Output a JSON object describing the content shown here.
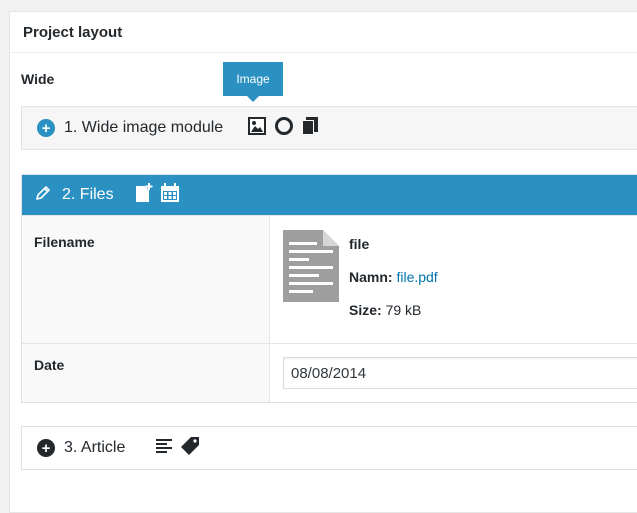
{
  "panel": {
    "title": "Project layout"
  },
  "section": {
    "label": "Wide"
  },
  "tooltip": {
    "text": "Image"
  },
  "modules": [
    {
      "title": "1. Wide image module",
      "tools": [
        "image-icon",
        "circle-outline-icon",
        "copy-icon"
      ]
    },
    {
      "title": "2. Files",
      "tools": [
        "file-add-icon",
        "calendar-icon"
      ]
    },
    {
      "title": "3. Article",
      "tools": [
        "align-left-icon",
        "tag-icon"
      ]
    }
  ],
  "files": {
    "filename_label": "Filename",
    "file": {
      "name": "file",
      "namn_label": "Namn:",
      "namn_value": "file.pdf",
      "size_label": "Size:",
      "size_value": "79 kB"
    },
    "date_label": "Date",
    "date_value": "08/08/2014"
  },
  "colors": {
    "accent": "#2b91c3",
    "link": "#0073aa",
    "icon_dark": "#23282d"
  }
}
